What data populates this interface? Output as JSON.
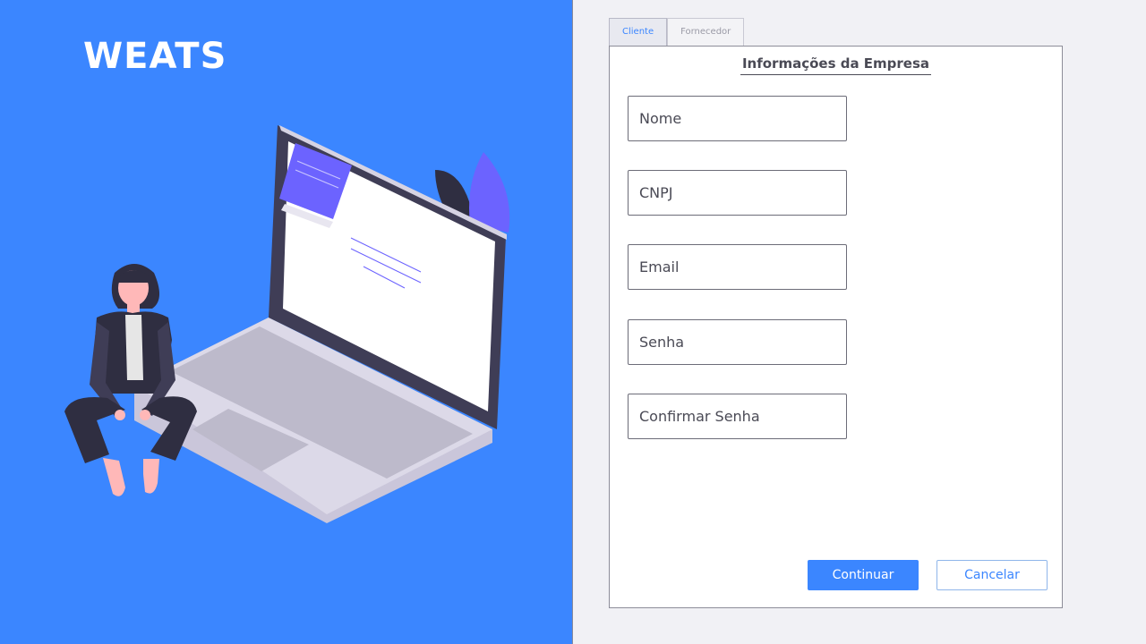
{
  "brand": {
    "name": "WEATS"
  },
  "tabs": [
    {
      "label": "Cliente",
      "active": true
    },
    {
      "label": "Fornecedor",
      "active": false
    }
  ],
  "form": {
    "title": "Informações da Empresa",
    "fields": [
      {
        "placeholder": "Nome",
        "value": ""
      },
      {
        "placeholder": "CNPJ",
        "value": ""
      },
      {
        "placeholder": "Email",
        "value": ""
      },
      {
        "placeholder": "Senha",
        "value": ""
      },
      {
        "placeholder": "Confirmar Senha",
        "value": ""
      }
    ],
    "buttons": {
      "continue_label": "Continuar",
      "cancel_label": "Cancelar"
    }
  },
  "colors": {
    "accent": "#3b86ff",
    "panel_bg": "#f1f1f5",
    "text": "#4a4a55",
    "illustration_purple": "#6c63ff"
  },
  "icons": [
    "person-with-laptop-illustration"
  ]
}
